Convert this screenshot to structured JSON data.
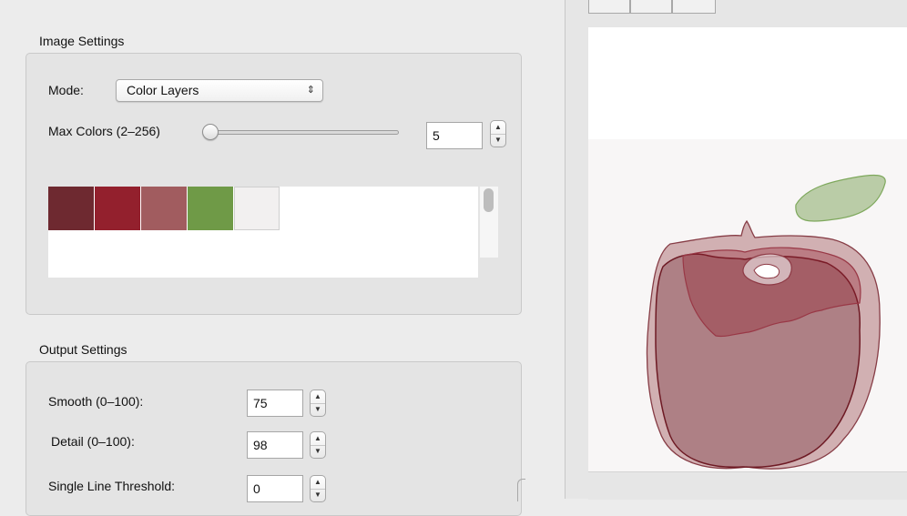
{
  "image_settings": {
    "title": "Image Settings",
    "mode_label": "Mode:",
    "mode_value": "Color Layers",
    "max_colors_label": "Max Colors (2–256)",
    "max_colors_value": "5",
    "slider_fraction": 0.01,
    "palette": [
      {
        "color": "#6e2930"
      },
      {
        "color": "#93202d"
      },
      {
        "color": "#a15c5f"
      },
      {
        "color": "#6f9a47"
      },
      {
        "color": "#f2f0f0"
      }
    ]
  },
  "output_settings": {
    "title": "Output Settings",
    "smooth_label": "Smooth (0–100):",
    "smooth_value": "75",
    "detail_label": "Detail (0–100):",
    "detail_value": "98",
    "threshold_label": "Single Line Threshold:",
    "threshold_value": "0"
  },
  "icons": {
    "popup_arrows": "up-down-chevron-icon",
    "stepper_up": "triangle-up-icon",
    "stepper_down": "triangle-down-icon"
  }
}
